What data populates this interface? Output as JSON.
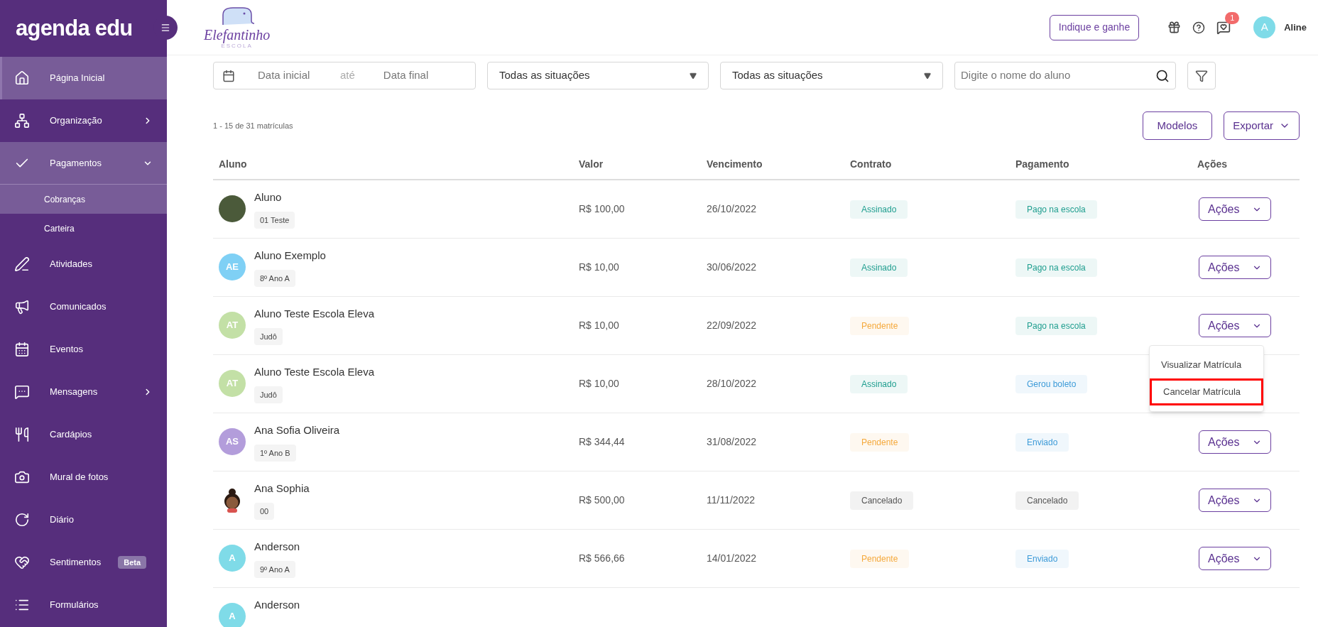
{
  "sidebar": {
    "logo": "agenda edu",
    "items": [
      {
        "label": "Página Inicial",
        "selected": true
      },
      {
        "label": "Organização",
        "selected": false,
        "expanded": false
      },
      {
        "label": "Pagamentos",
        "selected": false,
        "expanded": true,
        "children": [
          {
            "label": "Cobranças",
            "selected": true
          },
          {
            "label": "Carteira",
            "selected": false
          }
        ]
      },
      {
        "label": "Atividades",
        "selected": false
      },
      {
        "label": "Comunicados",
        "selected": false
      },
      {
        "label": "Eventos",
        "selected": false
      },
      {
        "label": "Mensagens",
        "selected": false,
        "expanded": false
      },
      {
        "label": "Cardápios",
        "selected": false
      },
      {
        "label": "Mural de fotos",
        "selected": false
      },
      {
        "label": "Diário",
        "selected": false
      },
      {
        "label": "Sentimentos",
        "selected": false,
        "badge": "Beta"
      },
      {
        "label": "Formulários",
        "selected": false
      }
    ]
  },
  "header": {
    "school": "Elefantinho",
    "school_sub": "ESCOLA",
    "invite_button": "Indique e ganhe",
    "notification_count": "1",
    "user_initial": "A",
    "user_name": "Aline"
  },
  "filters": {
    "date_start": {
      "placeholder": "Data inicial"
    },
    "date_separator": "até",
    "date_end": {
      "placeholder": "Data final"
    },
    "contract_select": "Todas as situações",
    "payment_select": "Todas as situações",
    "search": {
      "placeholder": "Digite o nome do aluno"
    }
  },
  "count": "1 - 15 de 31 matrículas",
  "buttons": {
    "models": "Modelos",
    "export": "Exportar"
  },
  "table": {
    "columns": [
      "Aluno",
      "Valor",
      "Vencimento",
      "Contrato",
      "Pagamento",
      "Ações"
    ],
    "rows": [
      {
        "avatar": {
          "kind": "photo"
        },
        "name": "Aluno",
        "group": "01 Teste",
        "value": "R$ 100,00",
        "due": "26/10/2022",
        "contract": {
          "text": "Assinado",
          "color": "#1f9e8f"
        },
        "payment": {
          "text": "Pago na escola",
          "color": "#1f9e8f"
        },
        "action": "Ações",
        "menu_open": false
      },
      {
        "avatar": {
          "kind": "initials",
          "text": "AE",
          "color": "#7fd0f5"
        },
        "name": "Aluno Exemplo",
        "group": "8º Ano A",
        "value": "R$ 10,00",
        "due": "30/06/2022",
        "contract": {
          "text": "Assinado",
          "color": "#1f9e8f"
        },
        "payment": {
          "text": "Pago na escola",
          "color": "#1f9e8f"
        },
        "action": "Ações",
        "menu_open": false
      },
      {
        "avatar": {
          "kind": "initials",
          "text": "AT",
          "color": "#c3e0a6"
        },
        "name": "Aluno Teste Escola Eleva",
        "group": "Judô",
        "value": "R$ 10,00",
        "due": "22/09/2022",
        "contract": {
          "text": "Pendente",
          "color": "#f5a93c"
        },
        "payment": {
          "text": "Pago na escola",
          "color": "#1f9e8f"
        },
        "action": "Ações",
        "menu_open": true,
        "menu": [
          {
            "label": "Visualizar Matrícula",
            "highlighted": false
          },
          {
            "label": "Cancelar Matrícula",
            "highlighted": true
          }
        ]
      },
      {
        "avatar": {
          "kind": "initials",
          "text": "AT",
          "color": "#c3e0a6"
        },
        "name": "Aluno Teste Escola Eleva",
        "group": "Judô",
        "value": "R$ 10,00",
        "due": "28/10/2022",
        "contract": {
          "text": "Assinado",
          "color": "#1f9e8f"
        },
        "payment": {
          "text": "Gerou boleto",
          "color": "#3d9bd8"
        }
      },
      {
        "avatar": {
          "kind": "initials",
          "text": "AS",
          "color": "#b39ddb"
        },
        "name": "Ana Sofia Oliveira",
        "group": "1º Ano B",
        "value": "R$ 344,44",
        "due": "31/08/2022",
        "contract": {
          "text": "Pendente",
          "color": "#f5a93c"
        },
        "payment": {
          "text": "Enviado",
          "color": "#3d9bd8"
        },
        "action": "Ações",
        "menu_open": false
      },
      {
        "avatar": {
          "kind": "illustration"
        },
        "name": "Ana Sophia",
        "group": "00",
        "value": "R$ 500,00",
        "due": "11/11/2022",
        "contract": {
          "text": "Cancelado",
          "color": "#555555"
        },
        "payment": {
          "text": "Cancelado",
          "color": "#555555"
        },
        "action": "Ações",
        "menu_open": false
      },
      {
        "avatar": {
          "kind": "initials",
          "text": "A",
          "color": "#7fdbe8"
        },
        "name": "Anderson",
        "group": "9º Ano A",
        "value": "R$ 566,66",
        "due": "14/01/2022",
        "contract": {
          "text": "Pendente",
          "color": "#f5a93c"
        },
        "payment": {
          "text": "Enviado",
          "color": "#3d9bd8"
        },
        "action": "Ações",
        "menu_open": false
      },
      {
        "avatar": {
          "kind": "initials",
          "text": "A",
          "color": "#7fdbe8"
        },
        "name": "Anderson"
      }
    ]
  }
}
